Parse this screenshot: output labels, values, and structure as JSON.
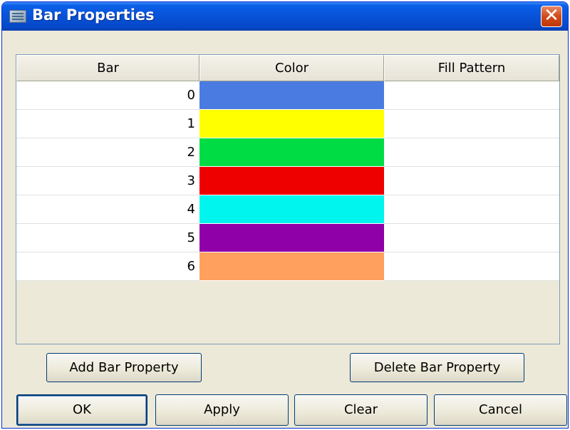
{
  "window": {
    "title": "Bar Properties",
    "close_symbol": "✕"
  },
  "table": {
    "headers": [
      "Bar",
      "Color",
      "Fill Pattern"
    ],
    "rows": [
      {
        "bar": "0",
        "color": "#4a7be0",
        "fill_pattern": ""
      },
      {
        "bar": "1",
        "color": "#ffff00",
        "fill_pattern": ""
      },
      {
        "bar": "2",
        "color": "#00dd44",
        "fill_pattern": ""
      },
      {
        "bar": "3",
        "color": "#ee0000",
        "fill_pattern": ""
      },
      {
        "bar": "4",
        "color": "#00f5ee",
        "fill_pattern": ""
      },
      {
        "bar": "5",
        "color": "#9000a8",
        "fill_pattern": ""
      },
      {
        "bar": "6",
        "color": "#ffa05e",
        "fill_pattern": ""
      }
    ]
  },
  "buttons": {
    "add": "Add Bar Property",
    "delete": "Delete Bar Property",
    "ok": "OK",
    "apply": "Apply",
    "clear": "Clear",
    "cancel": "Cancel"
  }
}
